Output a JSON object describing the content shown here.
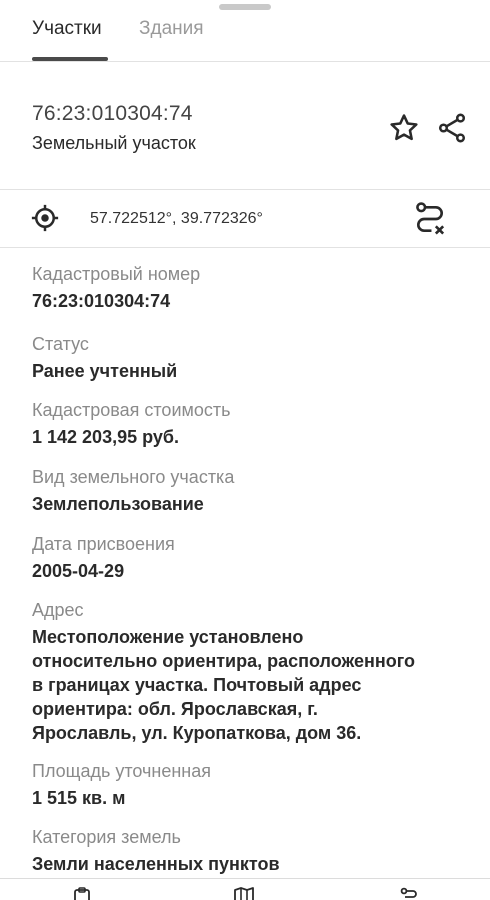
{
  "tabs": [
    {
      "label": "Участки",
      "active": true
    },
    {
      "label": "Здания",
      "active": false
    }
  ],
  "header": {
    "cadastral_number": "76:23:010304:74",
    "object_type": "Земельный участок"
  },
  "location": {
    "coordinates": "57.722512°, 39.772326°"
  },
  "fields": [
    {
      "label": "Кадастровый номер",
      "value": "76:23:010304:74"
    },
    {
      "label": "Статус",
      "value": "Ранее учтенный"
    },
    {
      "label": "Кадастровая стоимость",
      "value": "1 142 203,95 руб."
    },
    {
      "label": "Вид земельного участка",
      "value": "Землепользование"
    },
    {
      "label": "Дата присвоения",
      "value": "2005-04-29"
    },
    {
      "label": "Адрес",
      "value_lines": [
        "Местоположение установлено",
        "относительно ориентира, расположенного",
        "в границах участка. Почтовый адрес",
        "ориентира: обл. Ярославская, г.",
        "Ярославль, ул. Куропаткова, дом 36."
      ]
    },
    {
      "label": "Площадь уточненная",
      "value": "1 515 кв. м"
    },
    {
      "label": "Категория земель",
      "value": "Земли населенных пунктов"
    }
  ],
  "icons": {
    "favorite": "star-outline-icon",
    "share": "share-icon",
    "locate": "target-icon",
    "route": "route-clear-icon"
  },
  "colors": {
    "label_gray": "#8a8a8a",
    "text_dark": "#2a2a2a",
    "divider": "#e2e2e2"
  }
}
